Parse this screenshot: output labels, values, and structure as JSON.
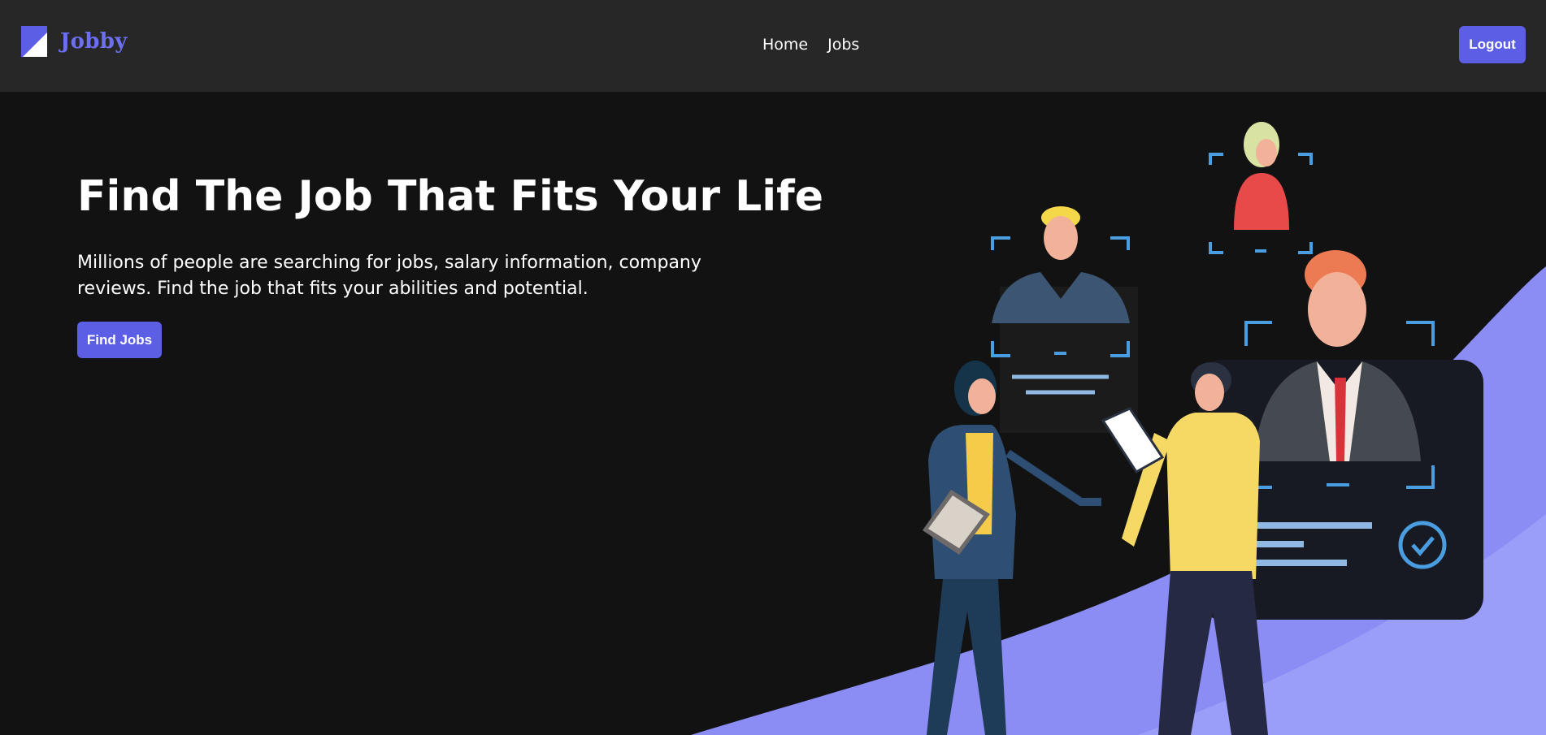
{
  "brand": {
    "name": "Jobby",
    "color": "#6c6ff0"
  },
  "nav": {
    "links": [
      {
        "label": "Home"
      },
      {
        "label": "Jobs"
      }
    ]
  },
  "header": {
    "logout_label": "Logout"
  },
  "hero": {
    "title": "Find The Job That Fits Your Life",
    "description": "Millions of people are searching for jobs, salary information, company reviews. Find the job that fits your abilities and potential.",
    "cta_label": "Find Jobs"
  },
  "colors": {
    "accent": "#5c5fe6",
    "navbar_bg": "#272727",
    "page_bg": "#121212",
    "wave": "#8b8df5",
    "frame": "#4a9de0"
  },
  "illustration": {
    "name": "hiring-team-illustration"
  }
}
